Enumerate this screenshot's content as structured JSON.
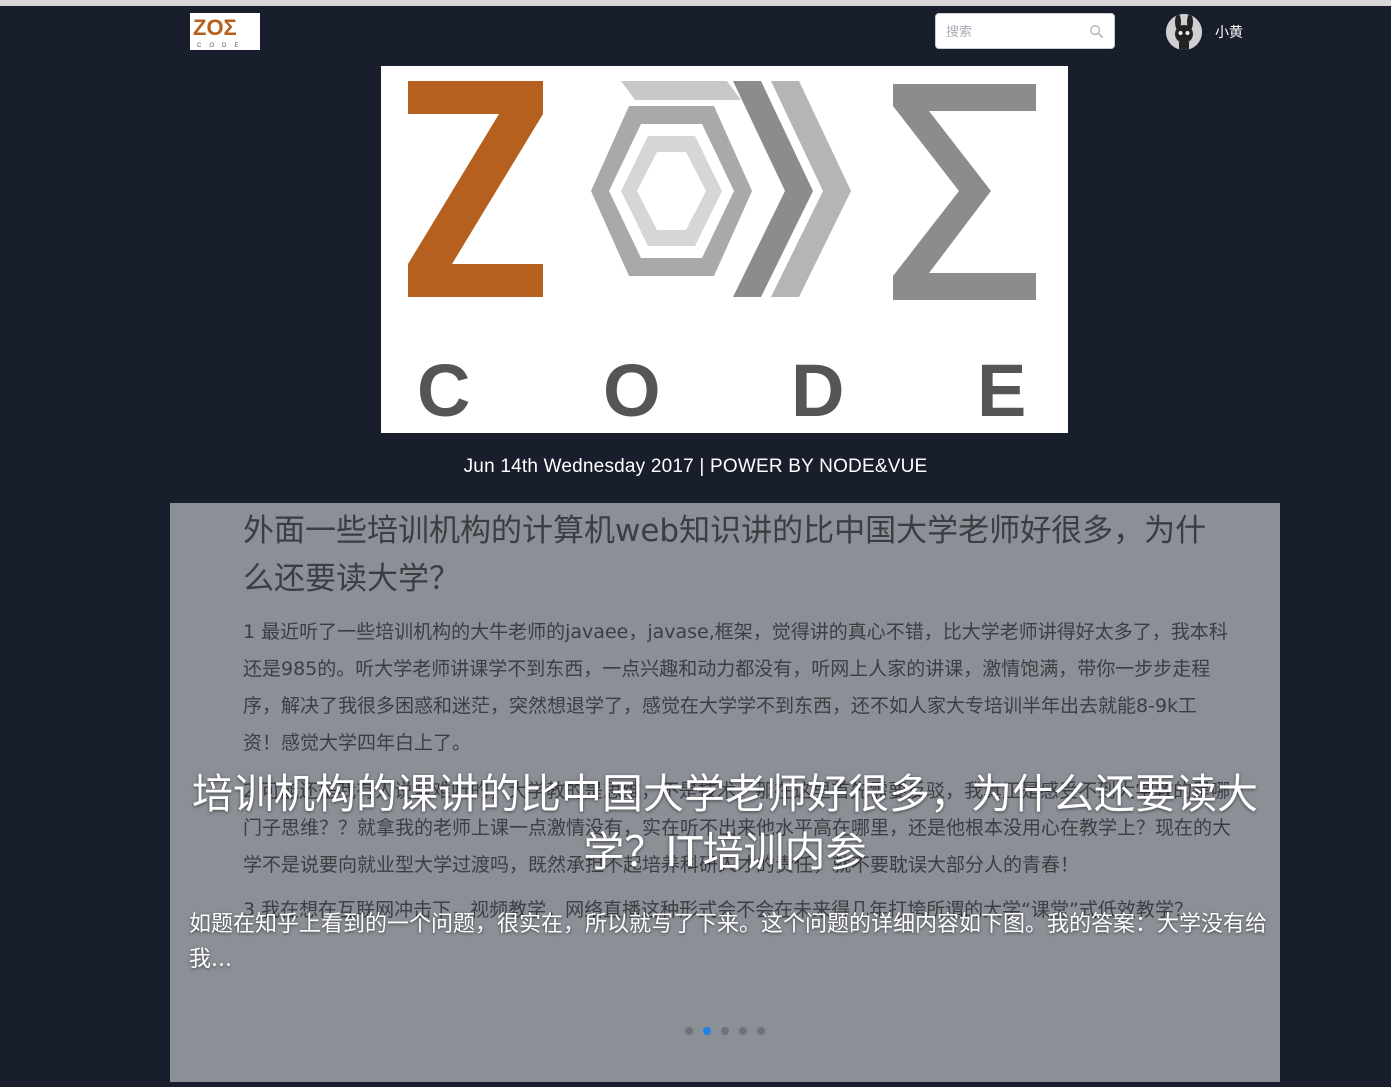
{
  "header": {
    "logo_letters": "ZOΣ",
    "logo_word": "CODE",
    "search": {
      "placeholder": "搜索"
    },
    "user": {
      "name": "小黄"
    }
  },
  "hero": {
    "logo_letters": "ZOΣ",
    "logo_word": [
      "C",
      "O",
      "D",
      "E"
    ],
    "tagline": "Jun 14th Wednesday 2017 | POWER BY NODE&VUE"
  },
  "carousel": {
    "image_text": {
      "question_title": "外面一些培训机构的计算机web知识讲的比中国大学老师好很多，为什么还要读大学？",
      "para1": "1 最近听了一些培训机构的大牛老师的javaee，javase,框架，觉得讲的真心不错，比大学老师讲得好太多了，我本科还是985的。听大学老师讲课学不到东西，一点兴趣和动力都没有，听网上人家的讲课，激情饱满，带你一步步走程序，解决了我很多困惑和迷茫，突然想退学了，感觉在大学学不到东西，还不如人家大专培训半年出去就能8-9k工资！感觉大学四年白上了。",
      "para2": "2 可能还是我有人说些难听的，大学教的是思维，不是技术，那在这里首先需要反驳，我真正是感受不到大学教的是哪门子思维？？就拿我的老师上课一点激情没有，实在听不出来他水平高在哪里，还是他根本没用心在教学上？现在的大学不是说要向就业型大学过渡吗，既然承担不起培养科研人才的责任，就不要耽误大部分人的青春！",
      "para3": "3 我在想在互联网冲击下，视频教学，网络直播这种形式会不会在未来得几年打垮所谓的大学“课堂”式低效教学？"
    },
    "caption": {
      "title": "培训机构的课讲的比中国大学老师好很多，为什么还要读大学？IT培训内参",
      "description": "如题在知乎上看到的一个问题，很实在，所以就写了下来。这个问题的详细内容如下图。我的答案：大学没有给我..."
    },
    "active_index": 1,
    "slide_count": 5
  },
  "colors": {
    "page_bg": "#181e2b",
    "logo_orange": "#b5601e",
    "logo_gray": "#8c8c8c",
    "carousel_bg": "#8b8f96",
    "dot_active": "#1e82e6"
  }
}
